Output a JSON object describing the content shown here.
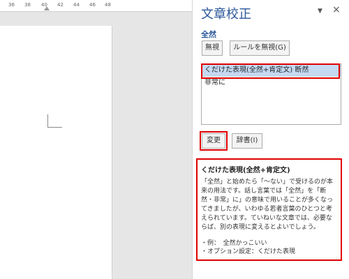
{
  "ruler": {
    "ticks": [
      "36",
      "38",
      "40",
      "42",
      "44",
      "46",
      "48"
    ]
  },
  "pane": {
    "title": "文章校正",
    "menu_glyph": "▼",
    "close_glyph": "×",
    "flagged_word": "全然",
    "buttons": {
      "ignore": "無視",
      "ignore_rule": "ルールを無視(G)",
      "change": "変更",
      "dictionary": "辞書(I)"
    },
    "suggestions": [
      "くだけた表現(全然+肯定文) 断然",
      "非常に"
    ],
    "explanation": {
      "title": "くだけた表現(全然+肯定文)",
      "body": "「全然」と始めたら「～ない」で受けるのが本来の用法です。話し言葉では「全然」を「断然・非常」に」の意味で用いることが多くなってきましたが、いわゆる若者言葉のひとつと考えられています。ていねいな文章では、必要ならば、別の表現に変えるとよいでしょう。",
      "example": "・例：　全然かっこいい",
      "option": "・オプション設定：くだけた表現"
    }
  },
  "colors": {
    "accent": "#2b579a",
    "highlight": "#e00000",
    "selection": "#c5d9f1"
  }
}
